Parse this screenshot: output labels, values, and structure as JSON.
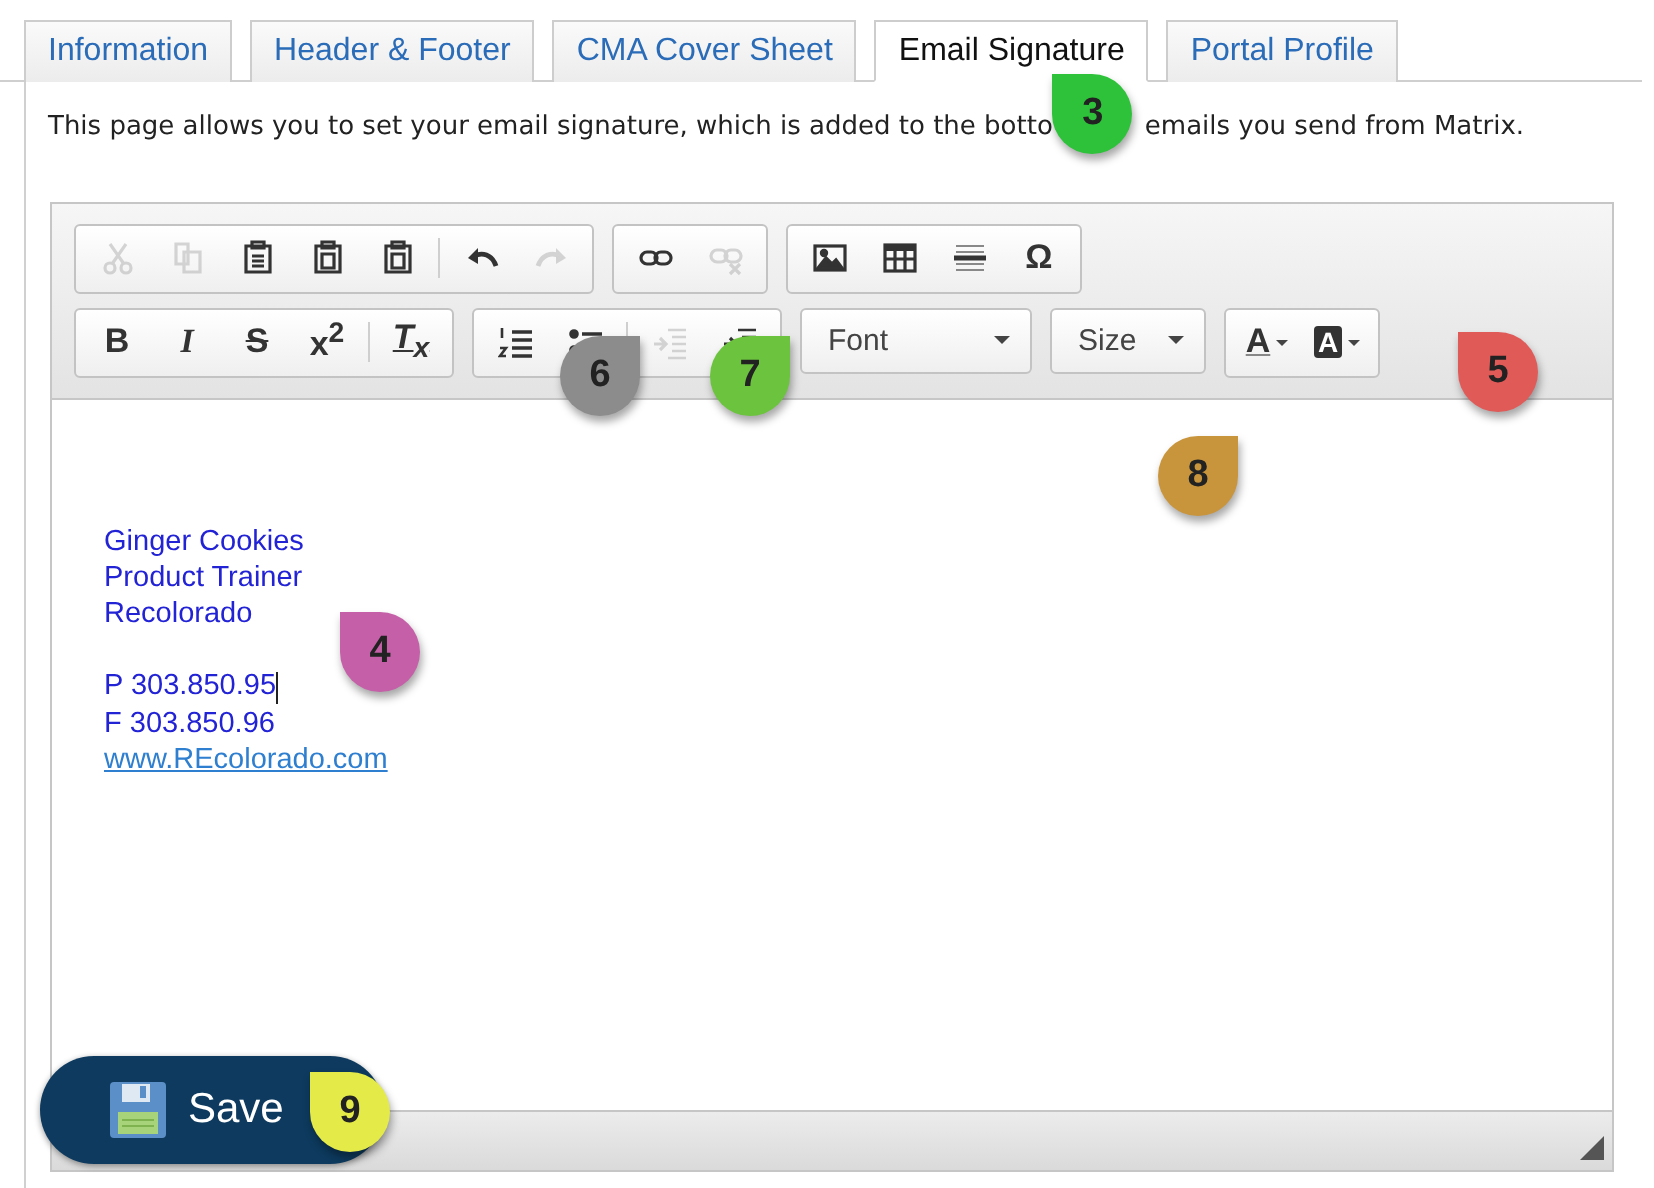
{
  "tabs": [
    {
      "label": "Information",
      "selected": false
    },
    {
      "label": "Header & Footer",
      "selected": false
    },
    {
      "label": "CMA Cover Sheet",
      "selected": false
    },
    {
      "label": "Email Signature",
      "selected": true
    },
    {
      "label": "Portal Profile",
      "selected": false
    }
  ],
  "description": {
    "before": "This page allows you to set your email signature, which is added to the botto",
    "after": "emails you send from Matrix."
  },
  "toolbar": {
    "rows": [
      [
        {
          "buttons": [
            {
              "kind": "cut",
              "disabled": true
            },
            {
              "kind": "copy",
              "disabled": true
            },
            {
              "kind": "paste",
              "disabled": false
            },
            {
              "kind": "paste-text",
              "disabled": false
            },
            {
              "kind": "paste-word",
              "disabled": false
            },
            {
              "kind": "separator"
            },
            {
              "kind": "undo",
              "disabled": false
            },
            {
              "kind": "redo",
              "disabled": true
            }
          ]
        },
        {
          "buttons": [
            {
              "kind": "link",
              "disabled": false
            },
            {
              "kind": "unlink",
              "disabled": true
            }
          ]
        },
        {
          "buttons": [
            {
              "kind": "image",
              "disabled": false
            },
            {
              "kind": "table",
              "disabled": false
            },
            {
              "kind": "rule",
              "disabled": false
            },
            {
              "kind": "glyph",
              "glyph": "Ω",
              "disabled": false
            }
          ]
        }
      ],
      [
        {
          "buttons": [
            {
              "kind": "bold",
              "glyph": "B",
              "disabled": false
            },
            {
              "kind": "italic",
              "glyph": "I",
              "disabled": false
            },
            {
              "kind": "strike",
              "glyph": "S",
              "disabled": false
            },
            {
              "kind": "glyph",
              "glyph": "x$^{2}$",
              "disabled": false
            },
            {
              "kind": "separator"
            },
            {
              "kind": "clear",
              "glyph": "T$_{x}$",
              "disabled": false
            }
          ]
        },
        {
          "buttons": [
            {
              "kind": "numbered-list",
              "disabled": false
            },
            {
              "kind": "bulleted-list",
              "disabled": false
            },
            {
              "kind": "separator"
            },
            {
              "kind": "outdent",
              "disabled": true
            },
            {
              "kind": "indent",
              "disabled": false
            }
          ]
        },
        {
          "dropdown": "Font"
        },
        {
          "dropdown": "Size"
        },
        {
          "buttons": [
            {
              "kind": "text-color",
              "glyph": "A",
              "disabled": false
            },
            {
              "kind": "bg-color",
              "glyph": "A",
              "disabled": false
            }
          ]
        }
      ]
    ]
  },
  "signature": [
    {
      "lines": [
        {
          "text": "Ginger Cookies",
          "kind": "text",
          "caret": false
        },
        {
          "text": "Product Trainer",
          "kind": "text",
          "caret": false
        },
        {
          "text": "Recolorado",
          "kind": "text",
          "caret": false
        }
      ]
    },
    {
      "lines": [
        {
          "text": "P 303.850.95",
          "kind": "text",
          "caret": true
        },
        {
          "text": "F 303.850.96",
          "kind": "text",
          "caret": false
        },
        {
          "text": "www.REcolorado.com",
          "kind": "link",
          "caret": false
        }
      ]
    }
  ],
  "save_button": {
    "label": "Save"
  },
  "callouts": [
    {
      "number": "3",
      "color": "#2ec23a"
    },
    {
      "number": "6",
      "color": "#8c8c8c"
    },
    {
      "number": "7",
      "color": "#6cc43e"
    },
    {
      "number": "5",
      "color": "#e05a58"
    },
    {
      "number": "8",
      "color": "#c9953c"
    },
    {
      "number": "4",
      "color": "#c45fa8"
    },
    {
      "number": "9",
      "color": "#e4ea48"
    }
  ]
}
